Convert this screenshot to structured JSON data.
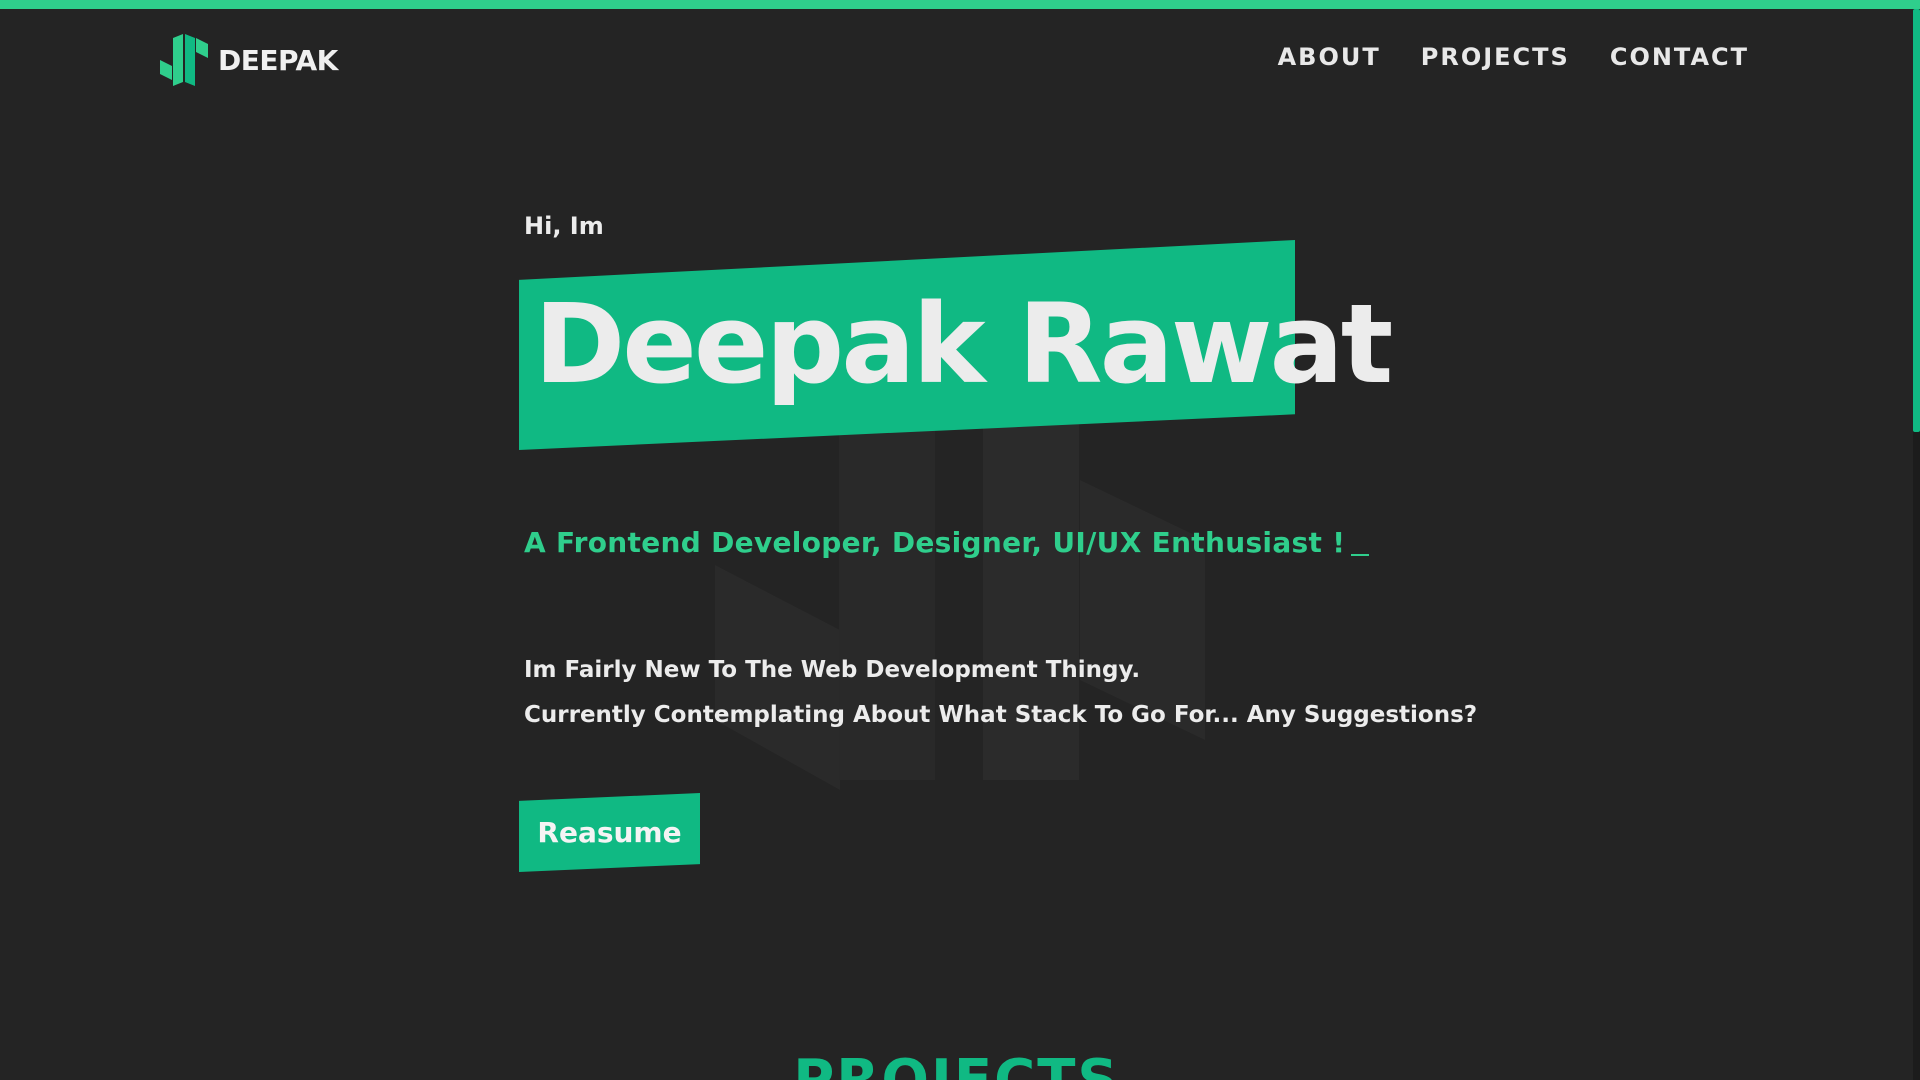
{
  "brand": {
    "name": "DEEPAK",
    "accent_color": "#10b983",
    "accent_light_color": "#2fce8c",
    "background_color": "#242424"
  },
  "nav": {
    "items": [
      {
        "label": "ABOUT"
      },
      {
        "label": "PROJECTS"
      },
      {
        "label": "CONTACT"
      }
    ]
  },
  "hero": {
    "greeting": "Hi, Im",
    "name": "Deepak Rawat",
    "tagline": "A Frontend Developer, Designer, UI/UX Enthusiast !",
    "intro_lines": [
      "Im Fairly New To The Web Development Thingy.",
      "Currently Contemplating About What Stack To Go For... Any Suggestions?"
    ],
    "resume_label": "Reasume"
  },
  "sections": {
    "projects_heading": "PROJECTS"
  },
  "icons": {
    "logo": "logo-mark-icon",
    "watermark": "logo-watermark-icon"
  }
}
